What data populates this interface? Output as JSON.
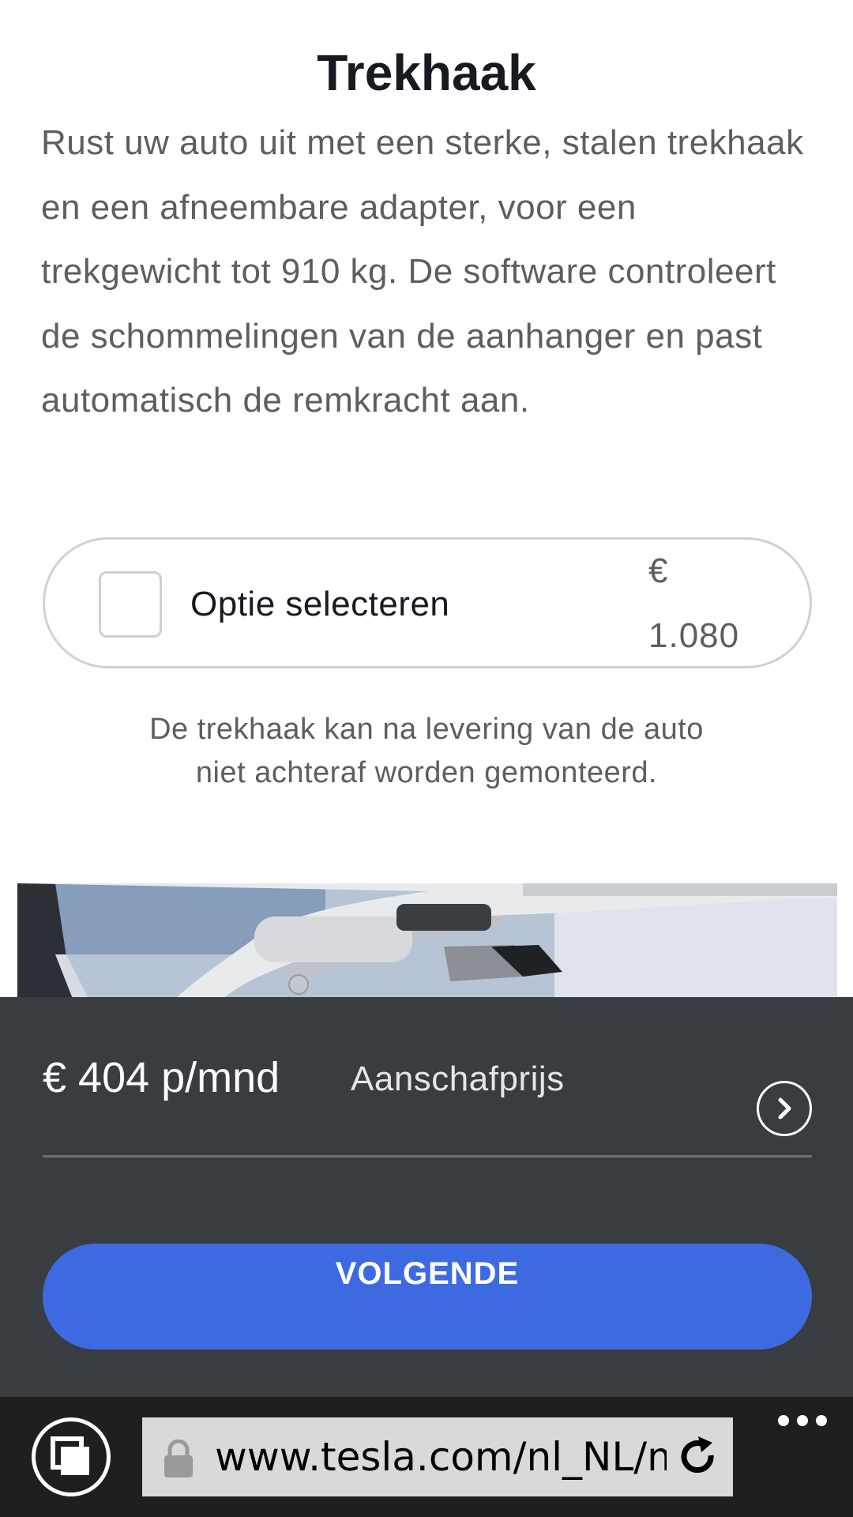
{
  "section": {
    "title": "Trekhaak",
    "description": "Rust uw auto uit met een sterke, stalen trekhaak en een afneembare adapter, voor een trekgewicht tot 910 kg. De software controleert de schommelingen van de aanhanger en past automatisch de remkracht aan."
  },
  "option": {
    "label": "Optie selecteren",
    "currency": "€",
    "price": "1.080",
    "selected": false
  },
  "note": "De trekhaak kan na levering van de auto niet achteraf worden gemonteerd.",
  "footer": {
    "price": "€ 404 p/mnd",
    "price_label": "Aanschafprijs",
    "next_label": "VOLGENDE"
  },
  "browser": {
    "url": "www.tesla.com/nl_NL/mc"
  },
  "colors": {
    "accent": "#3e6ae1",
    "footer_bg": "#393c41",
    "browser_bg": "#1f1f1f"
  }
}
